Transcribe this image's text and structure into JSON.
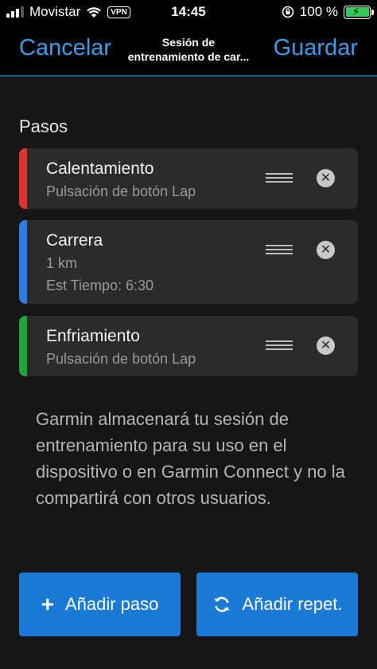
{
  "status_bar": {
    "carrier": "Movistar",
    "vpn": "VPN",
    "time": "14:45",
    "battery": "100 %",
    "icons": [
      "signal-icon",
      "wifi-icon",
      "orientation-lock-icon",
      "battery-charging-icon"
    ]
  },
  "nav": {
    "cancel_label": "Cancelar",
    "title_line1": "Sesión de",
    "title_line2": "entrenamiento de car...",
    "save_label": "Guardar"
  },
  "steps_section": {
    "title": "Pasos",
    "steps": [
      {
        "name": "Calentamiento",
        "detail": "Pulsación de botón Lap",
        "color": "#e0322f"
      },
      {
        "name": "Carrera",
        "detail": "1 km",
        "detail2": "Est Tiempo: 6:30",
        "color": "#2b7de0"
      },
      {
        "name": "Enfriamiento",
        "detail": "Pulsación de botón Lap",
        "color": "#20a33b"
      }
    ]
  },
  "info_text": "Garmin almacenará tu sesión de entrenamiento para su uso en el dispositivo o en Garmin Connect y no la compartirá con otros usuarios.",
  "actions": {
    "add_step_icon": "plus-icon",
    "add_step_label": "Añadir paso",
    "add_repeat_icon": "repeat-icon",
    "add_repeat_label": "Añadir repet."
  },
  "colors": {
    "accent": "#3d9ce8",
    "button": "#1a7ad6",
    "background": "#161616",
    "card": "#2b2b2b"
  }
}
